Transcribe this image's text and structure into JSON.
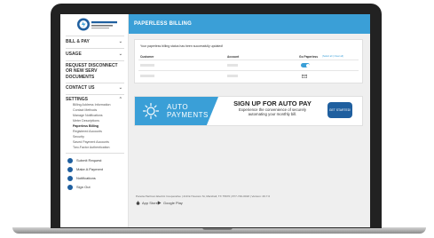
{
  "sidebar": {
    "logo_text": "Panola-Harrison Electric Cooperative",
    "nav": {
      "bill_pay": "BILL & PAY",
      "usage": "USAGE",
      "request_disconnect": "REQUEST DISCONNECT OR NEW SERV",
      "documents": "DOCUMENTS",
      "contact_us": "CONTACT US",
      "settings": "SETTINGS"
    },
    "settings_items": [
      "Billing Address Information",
      "Contact Methods",
      "Manage Notifications",
      "Meter Descriptions",
      "Paperless Billing",
      "Registered Accounts",
      "Security",
      "Saved Payment Accounts",
      "Two-Factor Authentication"
    ],
    "actions": [
      "Submit Request",
      "Make A Payment",
      "Notifications",
      "Sign Out"
    ]
  },
  "header": {
    "title": "PAPERLESS BILLING"
  },
  "paperless": {
    "status_message": "Your paperless billing status has been successfully updated!",
    "columns": [
      "Customer",
      "Account",
      "Go Paperless"
    ],
    "columns_link": "(Select all | Clear all)",
    "rows": [
      {
        "paperless_on": true
      },
      {
        "paperless_on": false
      }
    ]
  },
  "banner": {
    "icon": "sun-icon",
    "line1": "AUTO",
    "line2": "PAYMENTS",
    "headline": "SIGN UP FOR AUTO PAY",
    "desc_line1": "Experience the convenience of securely",
    "desc_line2": "automating your monthly bill.",
    "button_label": "GET STARTED!"
  },
  "footer": {
    "text": "Panola-Harrison Electric Cooperative  |  410 E Houston St, Marshall, TX 75670  |  877-740-0018  |  Version: 26.7.0",
    "app_store": "App Store",
    "google_play": "Google Play"
  },
  "colors": {
    "accent": "#3a9fd7",
    "dark_button": "#1f5f9f"
  }
}
